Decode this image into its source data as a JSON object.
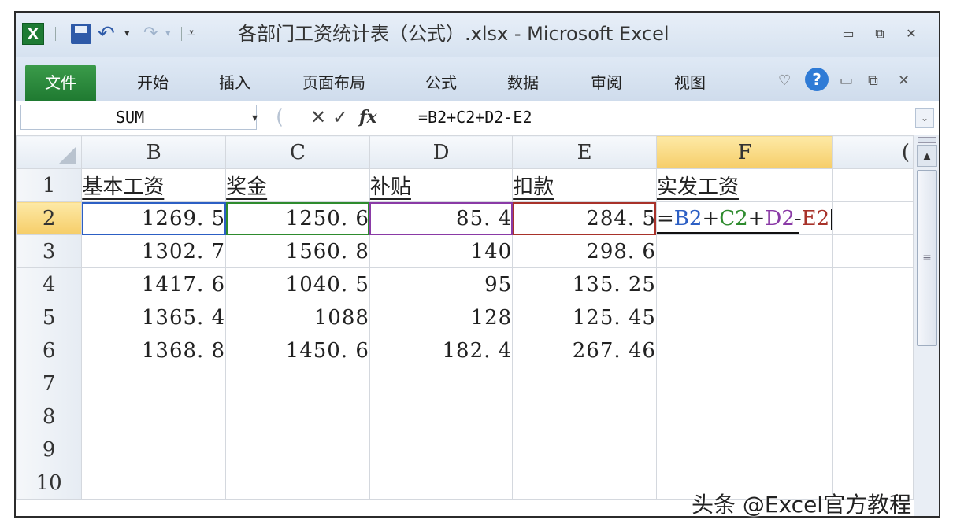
{
  "window": {
    "title": "各部门工资统计表（公式）.xlsx - Microsoft Excel",
    "app_icon_text": "X",
    "minimize_glyph": "▭",
    "maximize_glyph": "⧉",
    "close_glyph": "✕"
  },
  "quick_access": {
    "undo_glyph": "↶",
    "redo_glyph": "↷",
    "dropdown_glyph": "▾",
    "customize_glyph": "⩡"
  },
  "ribbon": {
    "file_tab": "文件",
    "tabs": [
      "开始",
      "插入",
      "页面布局",
      "公式",
      "数据",
      "审阅",
      "视图"
    ],
    "minimize_ribbon_glyph": "♡",
    "help_glyph": "?",
    "restore_glyph": "▭",
    "restore2_glyph": "⧉",
    "close_glyph": "✕"
  },
  "formula_bar": {
    "name_box": "SUM",
    "name_box_dropdown": "▾",
    "cancel_glyph": "✕",
    "enter_glyph": "✓",
    "fx_label": "fx",
    "formula": "=B2+C2+D2-E2",
    "expand_glyph": "⌄"
  },
  "sheet": {
    "column_headers": [
      "B",
      "C",
      "D",
      "E",
      "F",
      "("
    ],
    "selected_column": "F",
    "row_numbers": [
      "1",
      "2",
      "3",
      "4",
      "5",
      "6",
      "7",
      "8",
      "9",
      "10"
    ],
    "selected_row": "2",
    "header_row": [
      "基本工资",
      "奖金",
      "补贴",
      "扣款",
      "实发工资"
    ],
    "data_rows": [
      [
        "1269. 5",
        "1250. 6",
        "85. 4",
        "284. 5"
      ],
      [
        "1302. 7",
        "1560. 8",
        "140",
        "298. 6"
      ],
      [
        "1417. 6",
        "1040. 5",
        "95",
        "135. 25"
      ],
      [
        "1365. 4",
        "1088",
        "128",
        "125. 45"
      ],
      [
        "1368. 8",
        "1450. 6",
        "182. 4",
        "267. 46"
      ]
    ],
    "active_cell_formula_parts": [
      "=",
      "B2",
      "+",
      "C2",
      "+",
      "D2",
      "-",
      "E2"
    ],
    "reference_colors": {
      "B2": "#2c5fc4",
      "C2": "#2e8b2e",
      "D2": "#8a3aa6",
      "E2": "#a8322a"
    }
  },
  "scrollbar": {
    "up_glyph": "▲",
    "grip_glyph": "≡"
  },
  "watermark": "头条 @Excel官方教程"
}
